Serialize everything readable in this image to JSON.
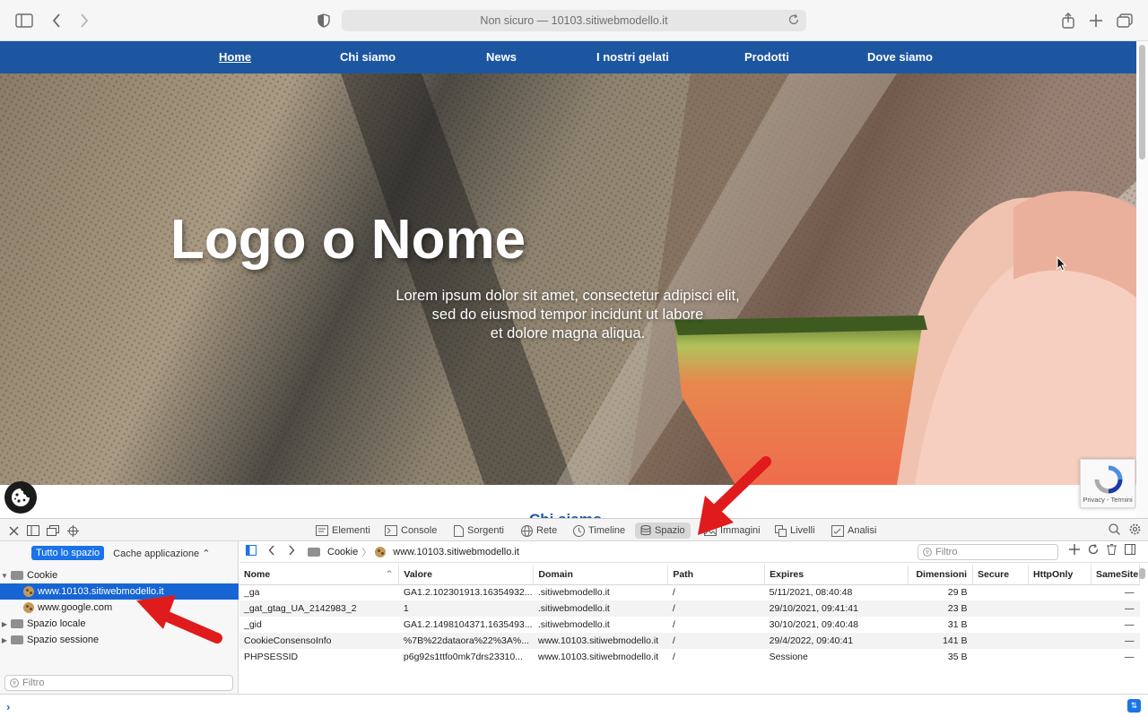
{
  "browser": {
    "url_text": "Non sicuro — 10103.sitiwebmodello.it"
  },
  "site": {
    "nav": [
      "Home",
      "Chi siamo",
      "News",
      "I nostri gelati",
      "Prodotti",
      "Dove siamo"
    ],
    "hero_title": "Logo o Nome",
    "hero_subtitle": [
      "Lorem ipsum dolor sit amet, consectetur adipisci elit,",
      "sed do eiusmod tempor incidunt ut labore",
      "et dolore magna aliqua."
    ],
    "next_heading": "Chi siamo",
    "recaptcha_label": "Privacy - Termini"
  },
  "devtools": {
    "tabs": [
      "Elementi",
      "Console",
      "Sorgenti",
      "Rete",
      "Timeline",
      "Spazio",
      "Immagini",
      "Livelli",
      "Analisi"
    ],
    "active_tab": "Spazio",
    "segment_on": "Tutto lo spazio",
    "segment_off": "Cache applicazione ⌃",
    "tree": {
      "cookie_folder": "Cookie",
      "cookie_site": "www.10103.sitiwebmodello.it",
      "google_site": "www.google.com",
      "local_storage": "Spazio locale",
      "session_storage": "Spazio sessione"
    },
    "sidebar_filter_placeholder": "Filtro",
    "breadcrumb_folder": "Cookie",
    "breadcrumb_site": "www.10103.sitiwebmodello.it",
    "filter_placeholder": "Filtro",
    "columns": [
      "Nome",
      "Valore",
      "Domain",
      "Path",
      "Expires",
      "Dimensioni",
      "Secure",
      "HttpOnly",
      "SameSite"
    ],
    "rows": [
      [
        "_ga",
        "GA1.2.102301913.16354932...",
        ".sitiwebmodello.it",
        "/",
        "5/11/2021, 08:40:48",
        "29 B",
        "",
        "",
        "—"
      ],
      [
        "_gat_gtag_UA_2142983_2",
        "1",
        ".sitiwebmodello.it",
        "/",
        "29/10/2021, 09:41:41",
        "23 B",
        "",
        "",
        "—"
      ],
      [
        "_gid",
        "GA1.2.1498104371.1635493...",
        ".sitiwebmodello.it",
        "/",
        "30/10/2021, 09:40:48",
        "31 B",
        "",
        "",
        "—"
      ],
      [
        "CookieConsensoInfo",
        "%7B%22dataora%22%3A%...",
        "www.10103.sitiwebmodello.it",
        "/",
        "29/4/2022, 09:40:41",
        "141 B",
        "",
        "",
        "—"
      ],
      [
        "PHPSESSID",
        "p6g92s1ttfo0mk7drs23310...",
        "www.10103.sitiwebmodello.it",
        "/",
        "Sessione",
        "35 B",
        "",
        "",
        "—"
      ]
    ],
    "console_prompt": "›"
  },
  "colors": {
    "nav_blue": "#1d56a0",
    "selection_blue": "#1765d4",
    "arrow_red": "#e01b1b"
  }
}
